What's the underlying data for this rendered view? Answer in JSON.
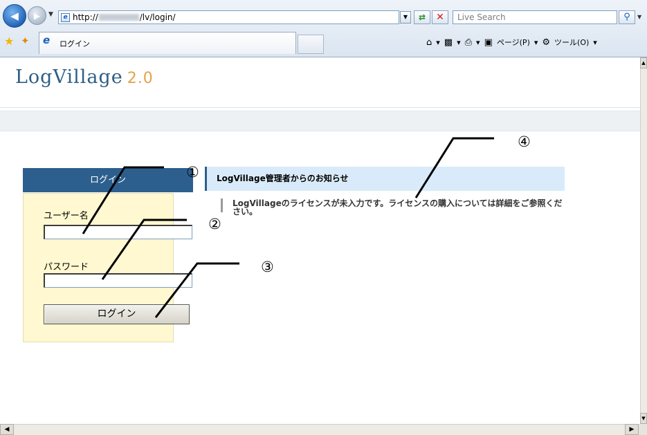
{
  "browser": {
    "address_prefix": "http://",
    "address_suffix": "/lv/login/",
    "search_placeholder": "Live Search",
    "tab_title": "ログイン",
    "cmd_page": "ページ(P)",
    "cmd_tools": "ツール(O)",
    "icons": {
      "back": "back-arrow-icon",
      "forward": "forward-arrow-icon",
      "refresh": "refresh-icon",
      "stop": "stop-icon",
      "search": "magnifier-icon",
      "favorites": "favorites-star-icon",
      "add_favorites": "add-favorites-icon",
      "home": "home-icon",
      "feeds": "feeds-icon",
      "print": "print-icon",
      "page": "page-icon",
      "tools": "gear-icon"
    }
  },
  "site": {
    "logo_main": "LogVillage",
    "logo_version": "2.0",
    "logo_main_color": "#2d5e86",
    "logo_version_color": "#e1a44a"
  },
  "login": {
    "heading": "ログイン",
    "username_label": "ユーザー名",
    "username_value": "",
    "password_label": "パスワード",
    "password_value": "",
    "submit_label": "ログイン",
    "header_color": "#2c5f8d",
    "panel_color": "#fff8d0"
  },
  "notice": {
    "heading": "LogVillage管理者からのお知らせ",
    "message": "LogVillageのライセンスが未入力です。ライセンスの購入については詳細をご参照ください。"
  },
  "annotations": [
    "①",
    "②",
    "③",
    "④"
  ]
}
